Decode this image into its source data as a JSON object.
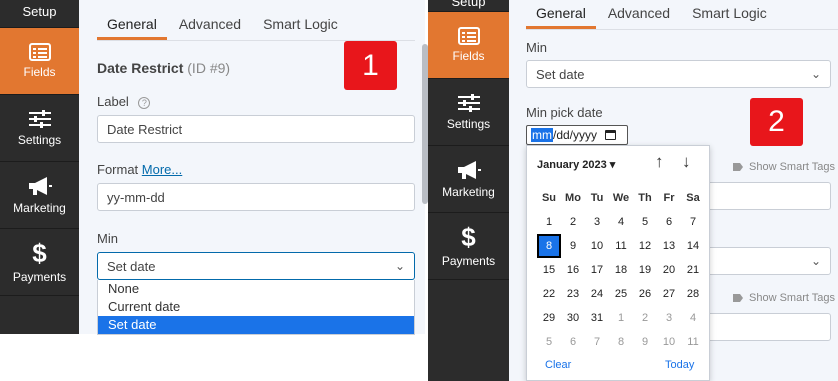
{
  "left": {
    "sidebar": {
      "setup_label": "Setup",
      "items": [
        {
          "label": "Fields",
          "icon": "fields-icon"
        },
        {
          "label": "Settings",
          "icon": "sliders-icon"
        },
        {
          "label": "Marketing",
          "icon": "megaphone-icon"
        },
        {
          "label": "Payments",
          "icon": "dollar-icon"
        }
      ]
    },
    "tabs": [
      "General",
      "Advanced",
      "Smart Logic"
    ],
    "field_title": "Date Restrict",
    "field_id": "(ID #9)",
    "label_title": "Label",
    "label_value": "Date Restrict",
    "format_title": "Format",
    "format_link": "More...",
    "format_value": "yy-mm-dd",
    "min_title": "Min",
    "min_value": "Set date",
    "dropdown_options": [
      "None",
      "Current date",
      "Set date"
    ],
    "badge": "1"
  },
  "right": {
    "sidebar": {
      "setup_label": "Setup",
      "items": [
        {
          "label": "Fields",
          "icon": "fields-icon"
        },
        {
          "label": "Settings",
          "icon": "sliders-icon"
        },
        {
          "label": "Marketing",
          "icon": "megaphone-icon"
        },
        {
          "label": "Payments",
          "icon": "dollar-icon"
        }
      ]
    },
    "tabs": [
      "General",
      "Advanced",
      "Smart Logic"
    ],
    "min_title": "Min",
    "min_value": "Set date",
    "min_pick_title": "Min pick date",
    "date_input": {
      "mm": "mm",
      "rest": "/dd/yyyy"
    },
    "smart_tags_label": "Show Smart Tags",
    "badge": "2",
    "calendar": {
      "month": "January 2023 ▾",
      "weekdays": [
        "Su",
        "Mo",
        "Tu",
        "We",
        "Th",
        "Fr",
        "Sa"
      ],
      "weeks": [
        [
          "1",
          "2",
          "3",
          "4",
          "5",
          "6",
          "7"
        ],
        [
          "8",
          "9",
          "10",
          "11",
          "12",
          "13",
          "14"
        ],
        [
          "15",
          "16",
          "17",
          "18",
          "19",
          "20",
          "21"
        ],
        [
          "22",
          "23",
          "24",
          "25",
          "26",
          "27",
          "28"
        ],
        [
          "29",
          "30",
          "31",
          "1",
          "2",
          "3",
          "4"
        ],
        [
          "5",
          "6",
          "7",
          "8",
          "9",
          "10",
          "11"
        ]
      ],
      "today": "8",
      "clear_label": "Clear",
      "today_label": "Today"
    }
  },
  "colors": {
    "accent": "#e27730",
    "sidebar": "#2c2c2c",
    "badge": "#e8161b",
    "select_blue": "#1a73e8"
  }
}
